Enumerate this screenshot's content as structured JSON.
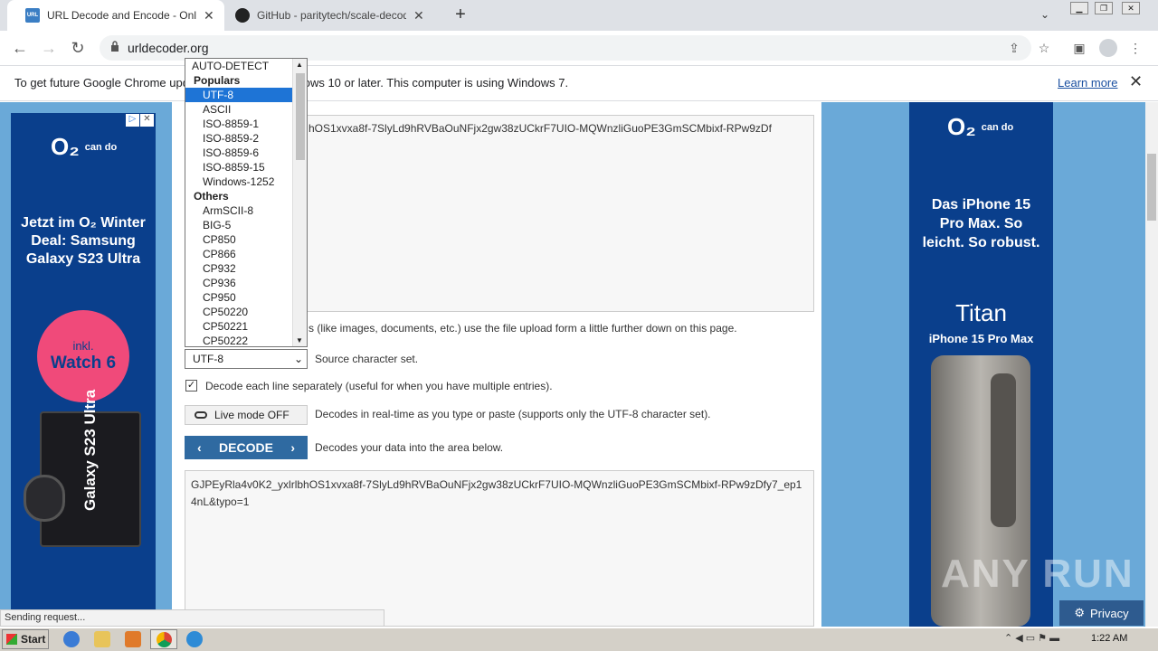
{
  "browser": {
    "tabs": [
      {
        "title": "URL Decode and Encode - Online",
        "favicon": "URL",
        "close": "✕"
      },
      {
        "title": "GitHub - paritytech/scale-decode: De",
        "close": "✕"
      }
    ],
    "new_tab": "+",
    "url": "urldecoder.org",
    "infobar": {
      "text": "To get future Google Chrome updates, you'll need Windows 10 or later. This computer is using Windows 7.",
      "learn_more": "Learn more"
    }
  },
  "charset_dropdown": {
    "top_option": "AUTO-DETECT",
    "groups": [
      {
        "label": "Populars",
        "options": [
          "UTF-8",
          "ASCII",
          "ISO-8859-1",
          "ISO-8859-2",
          "ISO-8859-6",
          "ISO-8859-15",
          "Windows-1252"
        ]
      },
      {
        "label": "Others",
        "options": [
          "ArmSCII-8",
          "BIG-5",
          "CP850",
          "CP866",
          "CP932",
          "CP936",
          "CP950",
          "CP50220",
          "CP50221",
          "CP50222"
        ]
      }
    ],
    "selected": "UTF-8"
  },
  "form": {
    "input_text": "hOS1xvxa8f-7SlyLd9hRVBaOuNFjx2gw38zUCkrF7UIO-MQWnzliGuoPE3GmSCMbixf-RPw9zDf",
    "file_hint": "s (like images, documents, etc.) use the file upload form a little further down on this page.",
    "charset_value": "UTF-8",
    "charset_label": "Source character set.",
    "decode_each_line_label": "Decode each line separately (useful for when you have multiple entries).",
    "live_mode_label": "Live mode OFF",
    "live_mode_desc": "Decodes in real-time as you type or paste (supports only the UTF-8 character set).",
    "decode_label": "DECODE",
    "decode_desc": "Decodes your data into the area below.",
    "output_text": "GJPEyRla4v0K2_yxlrlbhOS1xvxa8f-7SlyLd9hRVBaOuNFjx2gw38zUCkrF7UIO-MQWnzliGuoPE3GmSCMbixf-RPw9zDfy7_ep14nL&typo=1"
  },
  "ads": {
    "left": {
      "brand": "O₂",
      "tagline": "can do",
      "headline": "Jetzt im O₂ Winter Deal: Samsung Galaxy S23 Ultra",
      "badge_top": "inkl.",
      "badge_bottom": "Watch 6",
      "phone_text": "Galaxy S23 Ultra"
    },
    "right": {
      "brand": "O₂",
      "tagline": "can do",
      "headline": "Das iPhone 15 Pro Max. So leicht. So robust.",
      "product": "Titan",
      "product_sub": "iPhone 15 Pro Max"
    }
  },
  "status_bar": "Sending request...",
  "privacy_label": "Privacy",
  "watermark": "ANY RUN",
  "taskbar": {
    "start": "Start",
    "clock": "1:22 AM"
  }
}
